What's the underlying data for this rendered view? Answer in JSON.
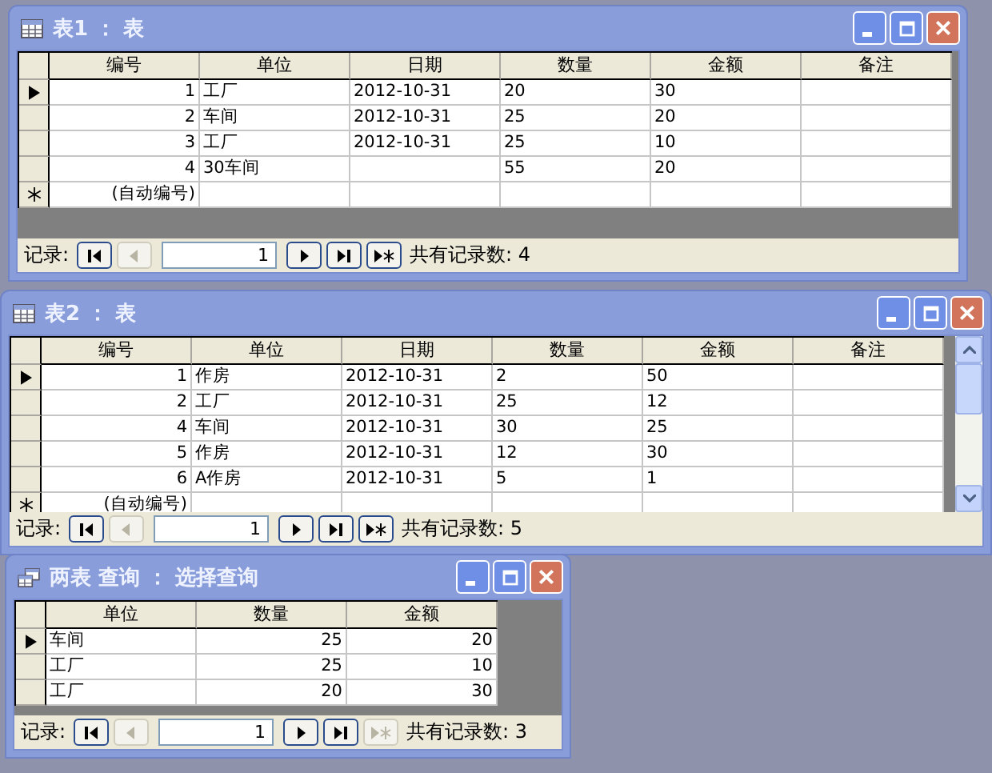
{
  "windows": [
    {
      "kind": "table",
      "title": "表1 ： 表",
      "vertical_scrollbar": false,
      "columns": [
        {
          "label": "编号",
          "kind": "number"
        },
        {
          "label": "单位",
          "kind": "text"
        },
        {
          "label": "日期",
          "kind": "text"
        },
        {
          "label": "数量",
          "kind": "text"
        },
        {
          "label": "金额",
          "kind": "text"
        },
        {
          "label": "备注",
          "kind": "text"
        }
      ],
      "rows": [
        {
          "selected": true,
          "cells": [
            "1",
            "工厂",
            "2012-10-31",
            "20",
            "30",
            null
          ]
        },
        {
          "selected": false,
          "cells": [
            "2",
            "车间",
            "2012-10-31",
            "25",
            "20",
            null
          ]
        },
        {
          "selected": false,
          "cells": [
            "3",
            "工厂",
            "2012-10-31",
            "25",
            "10",
            null
          ]
        },
        {
          "selected": false,
          "cells": [
            "4",
            "30车间",
            null,
            "55",
            "20",
            null
          ]
        }
      ],
      "new_row": {
        "cells": [
          "(自动编号)",
          null,
          null,
          null,
          null,
          null
        ]
      },
      "nav": {
        "label": "记录:",
        "record": "1",
        "count": "共有记录数: 4",
        "buttons": [
          {
            "kind": "first",
            "disabled": false
          },
          {
            "kind": "prev",
            "disabled": true
          },
          {
            "kind": "next",
            "disabled": false
          },
          {
            "kind": "last",
            "disabled": false
          },
          {
            "kind": "new",
            "disabled": false
          }
        ]
      }
    },
    {
      "kind": "table",
      "title": "表2 ： 表",
      "vertical_scrollbar": true,
      "columns": [
        {
          "label": "编号",
          "kind": "number"
        },
        {
          "label": "单位",
          "kind": "text"
        },
        {
          "label": "日期",
          "kind": "text"
        },
        {
          "label": "数量",
          "kind": "text"
        },
        {
          "label": "金额",
          "kind": "text"
        },
        {
          "label": "备注",
          "kind": "text"
        }
      ],
      "rows": [
        {
          "selected": true,
          "cells": [
            "1",
            "作房",
            "2012-10-31",
            "2",
            "50",
            null
          ]
        },
        {
          "selected": false,
          "cells": [
            "2",
            "工厂",
            "2012-10-31",
            "25",
            "12",
            null
          ]
        },
        {
          "selected": false,
          "cells": [
            "4",
            "车间",
            "2012-10-31",
            "30",
            "25",
            null
          ]
        },
        {
          "selected": false,
          "cells": [
            "5",
            "作房",
            "2012-10-31",
            "12",
            "30",
            null
          ]
        },
        {
          "selected": false,
          "cells": [
            "6",
            "A作房",
            "2012-10-31",
            "5",
            "1",
            null
          ]
        }
      ],
      "new_row": {
        "cells": [
          "(自动编号)",
          null,
          null,
          null,
          null,
          null
        ]
      },
      "nav": {
        "label": "记录:",
        "record": "1",
        "count": "共有记录数: 5",
        "buttons": [
          {
            "kind": "first",
            "disabled": false
          },
          {
            "kind": "prev",
            "disabled": true
          },
          {
            "kind": "next",
            "disabled": false
          },
          {
            "kind": "last",
            "disabled": false
          },
          {
            "kind": "new",
            "disabled": false
          }
        ]
      }
    },
    {
      "kind": "query",
      "title": "两表  查询 ： 选择查询",
      "vertical_scrollbar": false,
      "columns": [
        {
          "label": "单位",
          "kind": "text"
        },
        {
          "label": "数量",
          "kind": "number"
        },
        {
          "label": "金额",
          "kind": "number"
        }
      ],
      "rows": [
        {
          "selected": true,
          "cells": [
            "车间",
            "25",
            "20"
          ]
        },
        {
          "selected": false,
          "cells": [
            "工厂",
            "25",
            "10"
          ]
        },
        {
          "selected": false,
          "cells": [
            "工厂",
            "20",
            "30"
          ]
        }
      ],
      "nav": {
        "label": "记录:",
        "record": "1",
        "count": "共有记录数: 3",
        "buttons": [
          {
            "kind": "first",
            "disabled": false
          },
          {
            "kind": "prev",
            "disabled": true
          },
          {
            "kind": "next",
            "disabled": false
          },
          {
            "kind": "last",
            "disabled": false
          },
          {
            "kind": "new",
            "disabled": true
          }
        ]
      }
    }
  ]
}
